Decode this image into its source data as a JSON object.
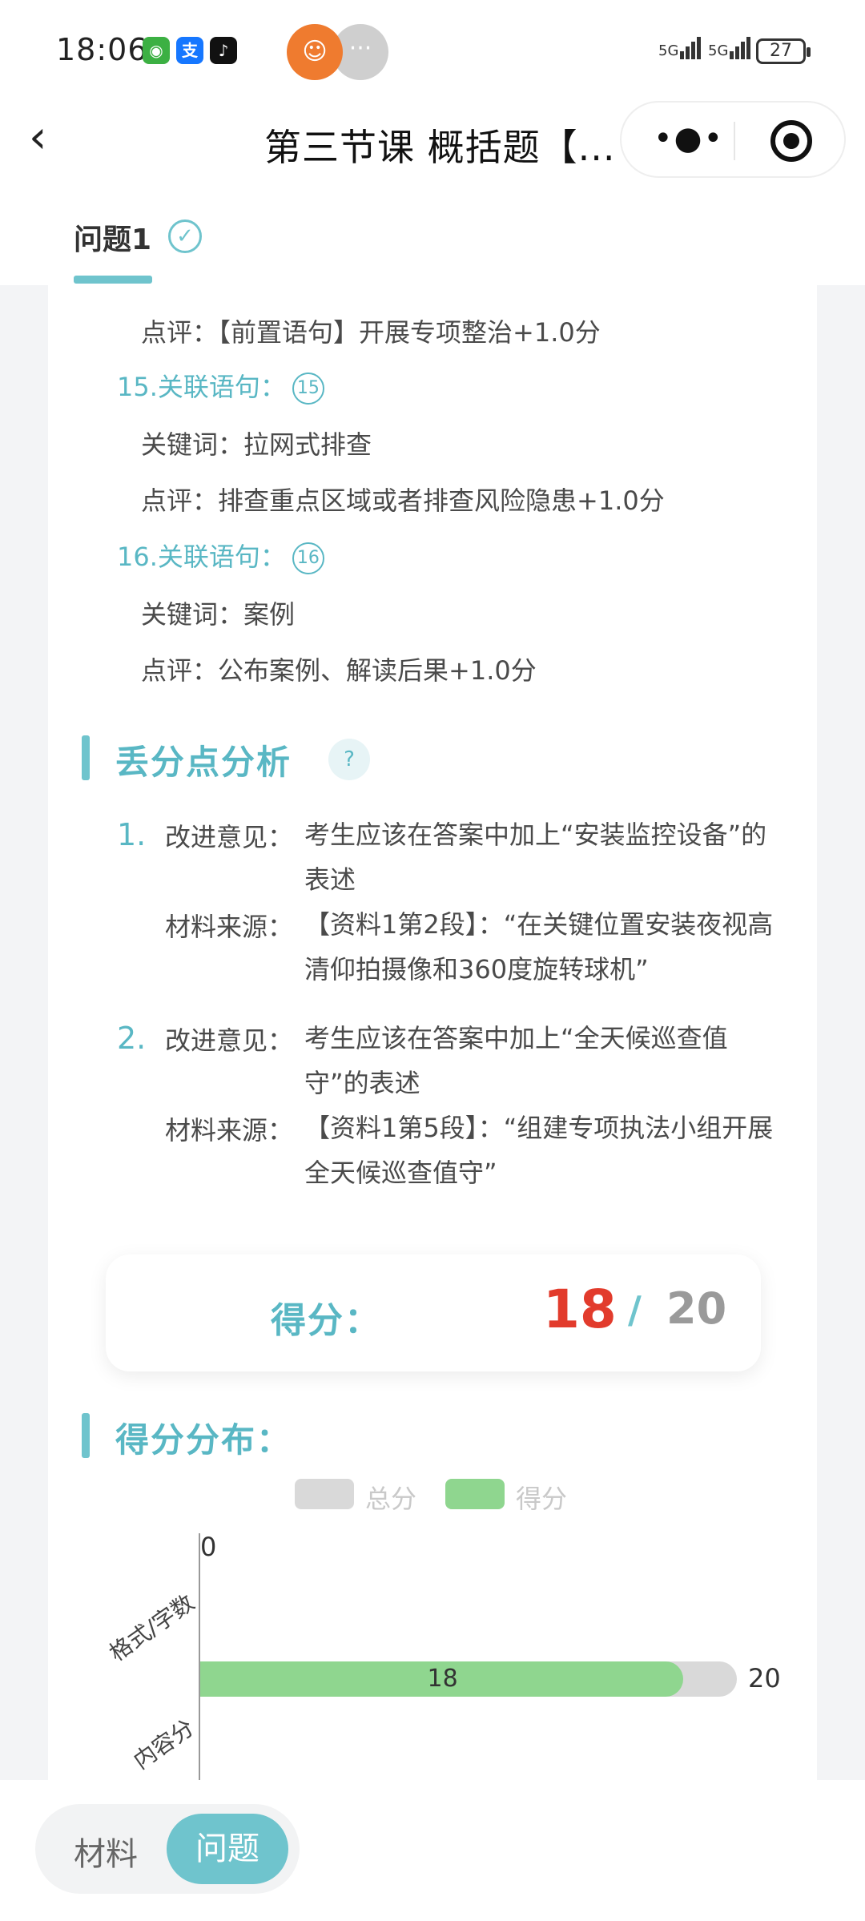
{
  "status_bar": {
    "time": "18:06",
    "signal1": "5G",
    "signal2": "5G",
    "battery": "27"
  },
  "nav": {
    "back_icon": "chevron-left-icon",
    "title": "第三节课 概括题【...",
    "more_icon": "more-dots-icon",
    "record_icon": "target-icon"
  },
  "tabs": [
    {
      "label": "问题1",
      "checked": true
    }
  ],
  "points": [
    {
      "comment_label": "点评：",
      "comment": "【前置语句】开展专项整治+1.0分"
    },
    {
      "title": "15.关联语句：",
      "badge": "15",
      "keyword_label": "关键词：",
      "keyword": "拉网式排查",
      "comment_label": "点评：",
      "comment": "排查重点区域或者排查风险隐患+1.0分"
    },
    {
      "title": "16.关联语句：",
      "badge": "16",
      "keyword_label": "关键词：",
      "keyword": "案例",
      "comment_label": "点评：",
      "comment": "公布案例、解读后果+1.0分"
    }
  ],
  "loss_section": {
    "title": "丢分点分析",
    "items": [
      {
        "num": "1.",
        "advice_label": "改进意见：",
        "advice": "考生应该在答案中加上“安装监控设备”的表述",
        "source_label": "材料来源：",
        "source": "【资料1第2段】：“在关键位置安装夜视高清仰拍摄像和360度旋转球机”"
      },
      {
        "num": "2.",
        "advice_label": "改进意见：",
        "advice": "考生应该在答案中加上“全天候巡查值守”的表述",
        "source_label": "材料来源：",
        "source": "【资料1第5段】：“组建专项执法小组开展全天候巡查值守”"
      }
    ]
  },
  "score": {
    "label": "得分：",
    "got": "18",
    "slash": "/",
    "total": "20"
  },
  "distribution": {
    "title": "得分分布："
  },
  "chart_data": {
    "type": "bar",
    "orientation": "horizontal",
    "categories": [
      "格式/字数",
      "内容分"
    ],
    "series": [
      {
        "name": "总分",
        "values": [
          0,
          20
        ],
        "color": "#d9d9d9"
      },
      {
        "name": "得分",
        "values": [
          0,
          18
        ],
        "color": "#8fd68f"
      }
    ],
    "xlim": [
      0,
      20
    ],
    "legend": "top-center"
  },
  "bottom_tabs": {
    "material": "材料",
    "question": "问题"
  },
  "colors": {
    "accent": "#59b7c4",
    "score_red": "#e23b2c"
  }
}
